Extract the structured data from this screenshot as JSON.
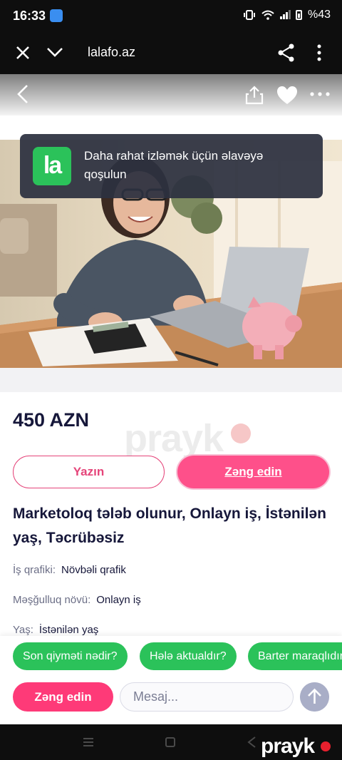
{
  "status_bar": {
    "time": "16:33",
    "battery": "%43",
    "icons": [
      "vibrate-icon",
      "wifi-icon",
      "signal-icon",
      "battery-icon"
    ]
  },
  "browser": {
    "url": "lalafo.az",
    "icons": [
      "close-icon",
      "chevron-down-icon",
      "share-icon",
      "more-vertical-icon"
    ]
  },
  "site_header": {
    "icons": [
      "back-icon",
      "upload-icon",
      "heart-icon",
      "more-horizontal-icon"
    ]
  },
  "app_banner": {
    "logo_text": "la",
    "text": "Daha rahat izləmək üçün əlavəyə qoşulun"
  },
  "listing": {
    "price": "450 AZN",
    "title": "Marketoloq tələb olunur, Onlayn iş, İstənilən yaş, Təcrübəsiz",
    "details": [
      {
        "label": "İş qrafiki:",
        "value": "Növbəli qrafik"
      },
      {
        "label": "Məşğulluq növü:",
        "value": "Onlayn iş"
      },
      {
        "label": "Yaş:",
        "value": "İstənilən yaş"
      }
    ]
  },
  "actions": {
    "write_label": "Yazın",
    "call_label": "Zəng edin"
  },
  "watermark": {
    "text": "prayk"
  },
  "quick_replies": [
    "Son qiyməti nədir?",
    "Hələ aktualdır?",
    "Barter maraqlıdır?"
  ],
  "message_bar": {
    "call_label": "Zəng edin",
    "placeholder": "Mesaj..."
  },
  "colors": {
    "accent_pink": "#fe508a",
    "brand_green": "#2bc25a",
    "dark_text": "#16173a"
  }
}
